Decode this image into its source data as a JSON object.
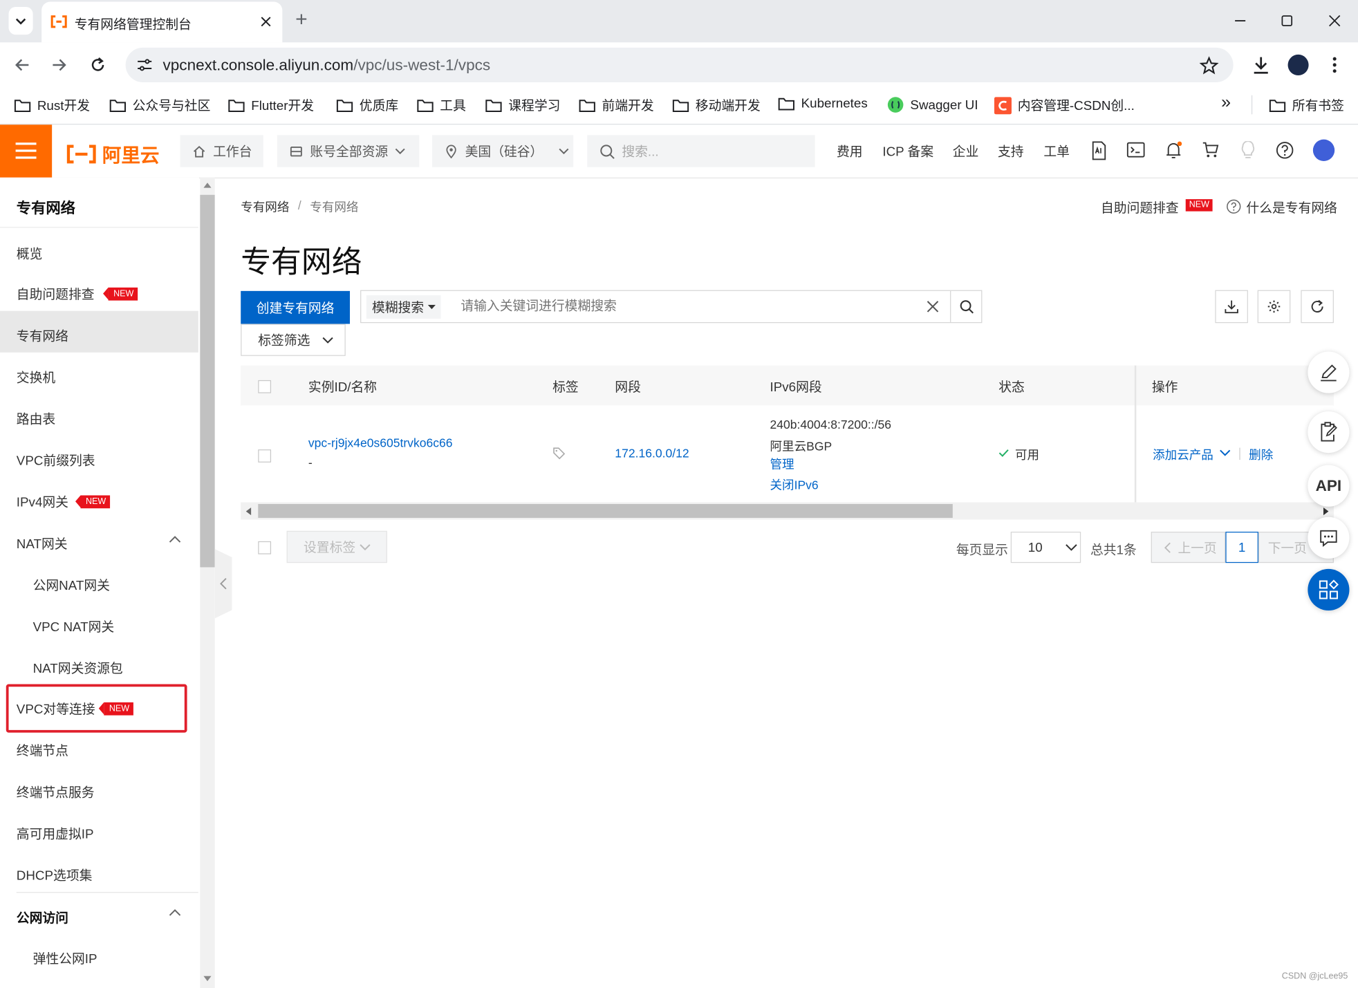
{
  "browser": {
    "tab_title": "专有网络管理控制台",
    "new_tab": "+",
    "url_host": "vpcnext.console.aliyun.com",
    "url_path": "/vpc/us-west-1/vpcs",
    "bookmarks": [
      "Rust开发",
      "公众号与社区",
      "Flutter开发",
      "优质库",
      "工具",
      "课程学习",
      "前端开发",
      "移动端开发",
      "Kubernetes",
      "Swagger UI",
      "内容管理-CSDN创..."
    ],
    "all_bookmarks": "所有书签",
    "more_bookmarks": "»"
  },
  "header": {
    "logo_text": "阿里云",
    "workbench": "工作台",
    "resources": "账号全部资源",
    "region": "美国（硅谷）",
    "search_placeholder": "搜索...",
    "nav": [
      "费用",
      "ICP 备案",
      "企业",
      "支持",
      "工单"
    ]
  },
  "sidebar": {
    "title": "专有网络",
    "new_badge": "NEW",
    "items": {
      "overview": "概览",
      "troubleshoot": "自助问题排查",
      "vpc": "专有网络",
      "vswitch": "交换机",
      "route_table": "路由表",
      "prefix_list": "VPC前缀列表",
      "ipv4_gateway": "IPv4网关",
      "nat_gateway": "NAT网关",
      "public_nat": "公网NAT网关",
      "vpc_nat": "VPC NAT网关",
      "nat_package": "NAT网关资源包",
      "peering": "VPC对等连接",
      "endpoint": "终端节点",
      "endpoint_service": "终端节点服务",
      "havip": "高可用虚拟IP",
      "dhcp": "DHCP选项集",
      "public_access": "公网访问",
      "eip": "弹性公网IP"
    }
  },
  "main": {
    "breadcrumb": [
      "专有网络",
      "专有网络"
    ],
    "breadcrumb_sep": "/",
    "troubleshoot_link": "自助问题排查",
    "new_badge": "NEW",
    "help_link": "什么是专有网络",
    "title": "专有网络",
    "create_button": "创建专有网络",
    "fuzzy_select": "模糊搜索",
    "search_placeholder": "请输入关键词进行模糊搜索",
    "tag_filter": "标签筛选",
    "table": {
      "headers": {
        "id": "实例ID/名称",
        "tag": "标签",
        "cidr": "网段",
        "ipv6": "IPv6网段",
        "status": "状态",
        "actions": "操作"
      },
      "rows": [
        {
          "id": "vpc-rj9jx4e0s605trvko6c66",
          "name": "-",
          "cidr": "172.16.0.0/12",
          "ipv6_cidr": "240b:4004:8:7200::/56",
          "ipv6_isp": "阿里云BGP",
          "ipv6_manage": "管理",
          "ipv6_disable": "关闭IPv6",
          "status": "可用",
          "action_add": "添加云产品",
          "action_delete": "删除"
        }
      ]
    },
    "set_tags": "设置标签",
    "pagination": {
      "per_page_label": "每页显示",
      "per_page": "10",
      "total": "总共1条",
      "prev": "上一页",
      "current": "1",
      "next": "下一页"
    },
    "api_label": "API"
  },
  "watermark": "CSDN @jcLee95",
  "colors": {
    "brand_orange": "#ff6a00",
    "primary_blue": "#0064c8",
    "badge_red": "#e8131c",
    "highlight_red": "#e0202c",
    "status_green": "#23b066"
  }
}
